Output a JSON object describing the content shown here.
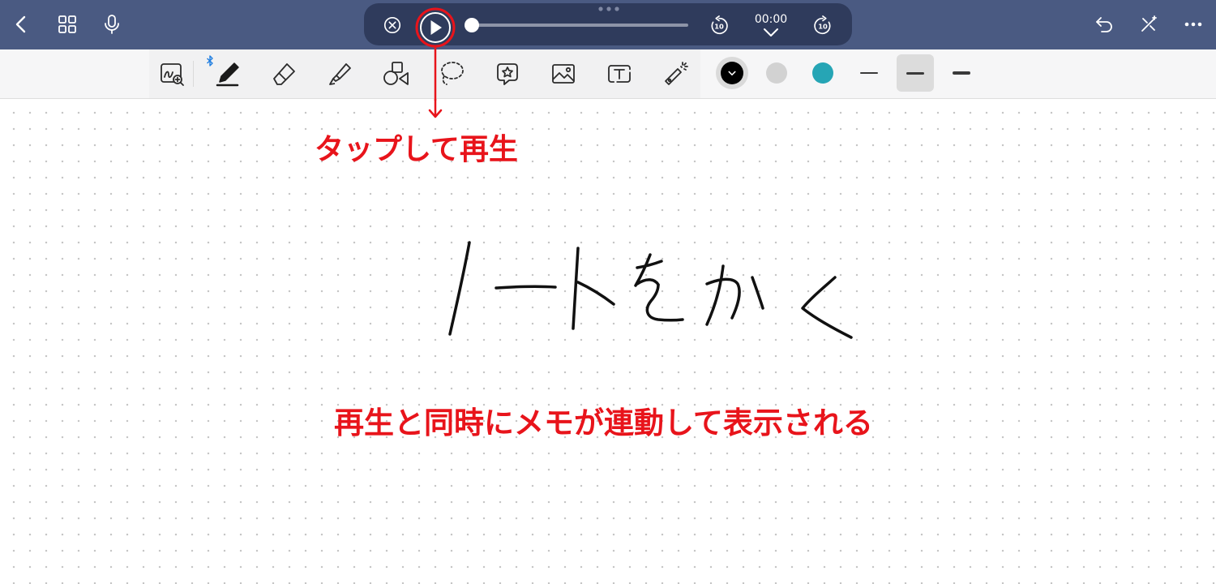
{
  "colors": {
    "topbar": "#4a5a82",
    "player_bg": "#2f3b5c",
    "annotation_red": "#e8141b",
    "swatch_black": "#000000",
    "swatch_gray": "#d2d2d2",
    "swatch_teal": "#26a5b5"
  },
  "topbar": {
    "left_icons": [
      "back-chevron-icon",
      "grid-icon",
      "microphone-icon"
    ],
    "right_icons": [
      "undo-icon",
      "edit-mode-icon",
      "more-icon"
    ]
  },
  "player": {
    "icons": [
      "close-icon",
      "play-icon",
      "rewind-10-icon",
      "forward-10-icon"
    ],
    "time": "00:00",
    "skip_seconds": "10",
    "progress": 0
  },
  "toolbar": {
    "tools": [
      "zoom-window-icon",
      "pen-icon",
      "eraser-icon",
      "highlighter-icon",
      "shapes-icon",
      "lasso-icon",
      "sticker-icon",
      "image-icon",
      "textbox-icon",
      "laser-pointer-icon"
    ],
    "bluetooth_icon": "bluetooth-icon",
    "selected_color": "#000000",
    "stroke_widths": [
      "thin",
      "medium",
      "thick"
    ],
    "selected_stroke": "medium"
  },
  "canvas": {
    "handwriting": "ノートをかく"
  },
  "annotations": {
    "tap_label": "タップして再生",
    "sync_label": "再生と同時にメモが連動して表示される"
  }
}
